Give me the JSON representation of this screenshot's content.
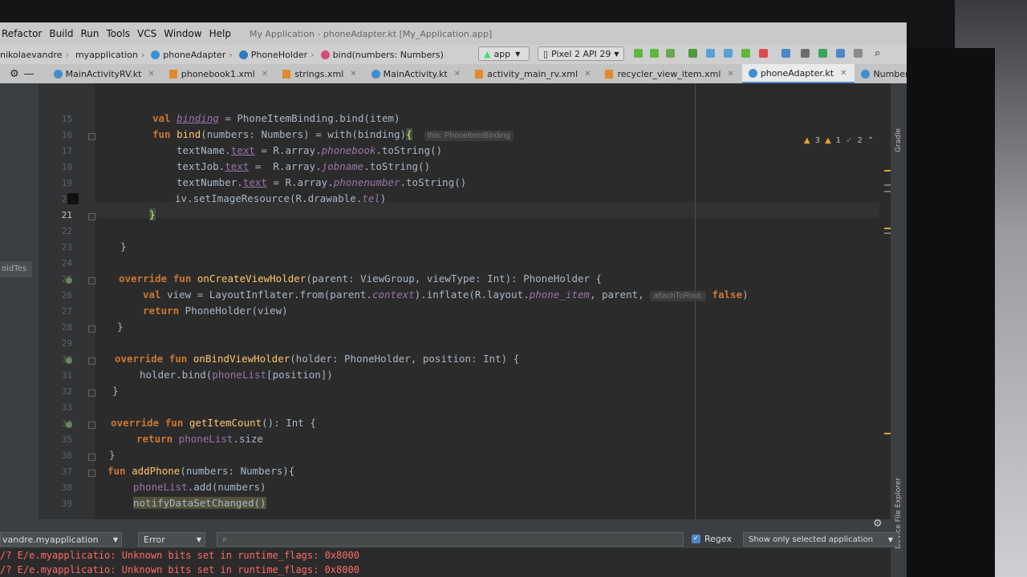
{
  "menubar": {
    "items": [
      "Refactor",
      "Build",
      "Run",
      "Tools",
      "VCS",
      "Window",
      "Help"
    ],
    "window_title": "My Application - phoneAdapter.kt [My_Application.app]"
  },
  "breadcrumbs": [
    "nikolaevandre",
    "myapplication",
    "phoneAdapter",
    "PhoneHolder",
    "bind(numbers: Numbers)"
  ],
  "toolbar": {
    "run_config": "app",
    "device": "Pixel 2 API 29"
  },
  "tabs": [
    {
      "label": "MainActivityRV.kt"
    },
    {
      "label": "phonebook1.xml"
    },
    {
      "label": "strings.xml"
    },
    {
      "label": "MainActivity.kt"
    },
    {
      "label": "activity_main_rv.xml"
    },
    {
      "label": "recycler_view_item.xml"
    },
    {
      "label": "phoneAdapter.kt"
    },
    {
      "label": "Numbers.kt"
    }
  ],
  "inspection": {
    "warnings": "3",
    "weak_warnings": "1",
    "typos": "2"
  },
  "left_panel_label": "oidTes",
  "line_numbers": [
    "15",
    "16",
    "17",
    "18",
    "19",
    "20",
    "21",
    "22",
    "23",
    "24",
    "25",
    "26",
    "27",
    "28",
    "29",
    "30",
    "31",
    "32",
    "33",
    "34",
    "35",
    "36",
    "37",
    "38",
    "39"
  ],
  "current_line": "21",
  "hints": {
    "receiver": "this: PhoneItemBinding",
    "param": "attachToRoot:"
  },
  "code": {
    "l15": {
      "kw": "val",
      "name": "binding",
      "rest": " = PhoneItemBinding.bind(item)"
    },
    "l16": {
      "kw": "fun",
      "name": "bind",
      "rest": "(numbers: Numbers) = with(binding)",
      "brace": "{"
    },
    "l17": {
      "lhs": "textName.",
      "prop": "text",
      "mid": " = R.array.",
      "res": "phonebook",
      "end": ".toString()"
    },
    "l18": {
      "lhs": "textJob.",
      "prop": "text",
      "mid": " =  R.array.",
      "res": "jobname",
      "end": ".toString()"
    },
    "l19": {
      "lhs": "textNumber.",
      "prop": "text",
      "mid": " = R.array.",
      "res": "phonenumber",
      "end": ".toString()"
    },
    "l20": {
      "pre": "iv.setImageResource(R.drawable.",
      "res": "tel",
      "end": ")"
    },
    "l21": "}",
    "l23": "}",
    "l25": {
      "kw": "override fun",
      "name": "onCreateViewHolder",
      "rest": "(parent: ViewGroup, viewType: Int): PhoneHolder {"
    },
    "l26": {
      "kw": "val",
      "rest1": " view = LayoutInflater.from(parent.",
      "ctx": "context",
      "rest2": ").inflate(R.layout.",
      "res": "phone_item",
      "rest3": ", parent, ",
      "kw2": "false",
      "end": ")"
    },
    "l27": {
      "kw": "return",
      "rest": " PhoneHolder(view)"
    },
    "l28": "}",
    "l30": {
      "kw": "override fun",
      "name": "onBindViewHolder",
      "rest": "(holder: PhoneHolder, position: Int) {"
    },
    "l31": {
      "pre": "holder.bind(",
      "prop": "phoneList",
      "end": "[position])"
    },
    "l32": "}",
    "l34": {
      "kw": "override fun",
      "name": "getItemCount",
      "rest": "(): Int {"
    },
    "l35": {
      "kw": "return",
      "prop": " phoneList",
      "end": ".size"
    },
    "l36": "}",
    "l37": {
      "kw": "fun",
      "name": "addPhone",
      "rest": "(numbers: Numbers){"
    },
    "l38": {
      "prop": "phoneList",
      "end": ".add(numbers)"
    },
    "l39": {
      "hl": "notifyDataSetChanged()"
    }
  },
  "logcat": {
    "app_select": "vandre.myapplication",
    "level": "Error",
    "regex_label": "Regex",
    "filter": "Show only selected application",
    "lines": [
      "/? E/e.myapplicatio: Unknown bits set in runtime_flags: 0x8000",
      "/? E/e.myapplicatio: Unknown bits set in runtime_flags: 0x8000"
    ]
  },
  "right_strip": [
    "Gradle",
    "Device File Explorer"
  ]
}
